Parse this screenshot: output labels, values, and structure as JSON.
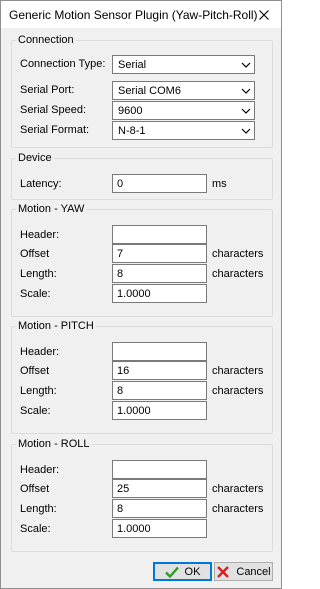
{
  "window": {
    "title": "Generic Motion Sensor Plugin (Yaw-Pitch-Roll)"
  },
  "connection": {
    "title": "Connection",
    "type_label": "Connection Type:",
    "type_value": "Serial",
    "port_label": "Serial Port:",
    "port_value": "Serial COM6",
    "speed_label": "Serial Speed:",
    "speed_value": "9600",
    "format_label": "Serial Format:",
    "format_value": "N-8-1"
  },
  "device": {
    "title": "Device",
    "latency_label": "Latency:",
    "latency_value": "0",
    "latency_unit": "ms"
  },
  "yaw": {
    "title": "Motion - YAW",
    "header_label": "Header:",
    "header_value": "",
    "offset_label": "Offset",
    "offset_value": "7",
    "offset_unit": "characters",
    "length_label": "Length:",
    "length_value": "8",
    "length_unit": "characters",
    "scale_label": "Scale:",
    "scale_value": "1.0000"
  },
  "pitch": {
    "title": "Motion - PITCH",
    "header_label": "Header:",
    "header_value": "",
    "offset_label": "Offset",
    "offset_value": "16",
    "offset_unit": "characters",
    "length_label": "Length:",
    "length_value": "8",
    "length_unit": "characters",
    "scale_label": "Scale:",
    "scale_value": "1.0000"
  },
  "roll": {
    "title": "Motion - ROLL",
    "header_label": "Header:",
    "header_value": "",
    "offset_label": "Offset",
    "offset_value": "25",
    "offset_unit": "characters",
    "length_label": "Length:",
    "length_value": "8",
    "length_unit": "characters",
    "scale_label": "Scale:",
    "scale_value": "1.0000"
  },
  "buttons": {
    "ok_label": "OK",
    "cancel_label": "Cancel"
  },
  "colors": {
    "ok_check": "#2e9a2e",
    "cancel_x": "#d42020",
    "focus_border": "#0078d7"
  }
}
